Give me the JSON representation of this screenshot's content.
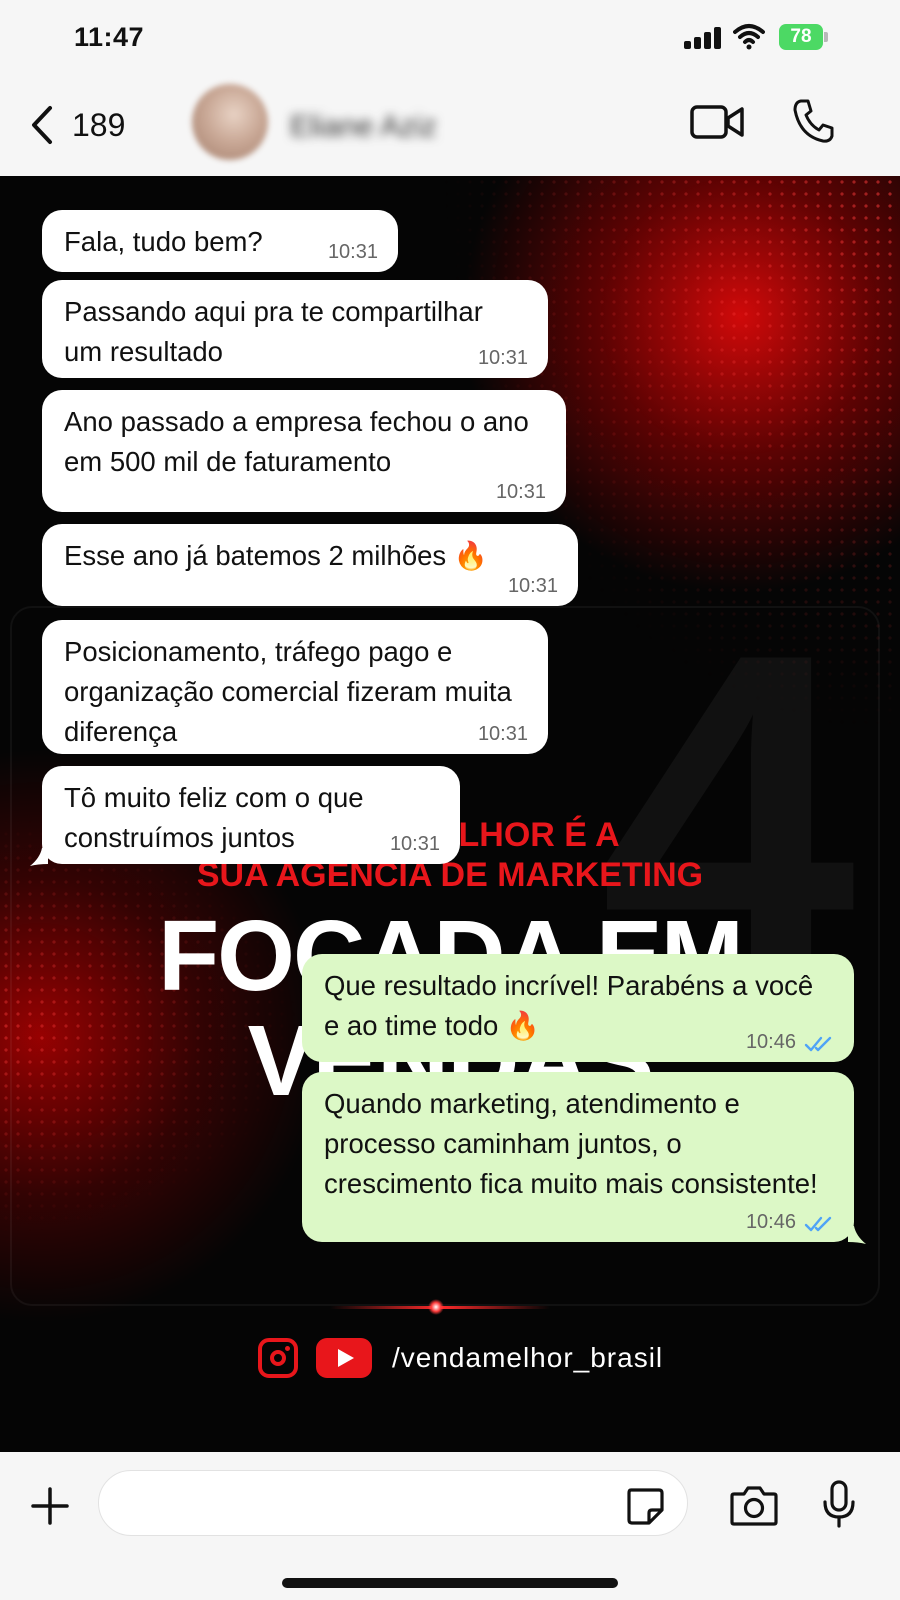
{
  "status_bar": {
    "time": "11:47",
    "battery": "78"
  },
  "header": {
    "back_count": "189",
    "contact_name": "Eliane Aziz",
    "icons": {
      "back": "chevron-left-icon",
      "video": "video-camera-icon",
      "call": "phone-icon"
    }
  },
  "wallpaper": {
    "subtitle_line1": "VENDA MELHOR É A",
    "subtitle_line2": "SUA AGÊNCIA DE MARKETING",
    "headline_line1": "FOCADA EM",
    "headline_line2": "VENDAS",
    "social_handle": "/vendamelhor_brasil",
    "accent_color": "#e8161b"
  },
  "messages": [
    {
      "direction": "in",
      "text": "Fala, tudo bem?",
      "time": "10:31"
    },
    {
      "direction": "in",
      "text": "Passando aqui pra te compartilhar um resultado",
      "time": "10:31"
    },
    {
      "direction": "in",
      "text": "Ano passado a empresa fechou o ano em 500 mil de faturamento",
      "time": "10:31"
    },
    {
      "direction": "in",
      "text": "Esse ano já batemos 2 milhões 🔥",
      "time": "10:31"
    },
    {
      "direction": "in",
      "text": "Posicionamento, tráfego pago e organização comercial fizeram muita diferença",
      "time": "10:31"
    },
    {
      "direction": "in",
      "text": "Tô muito feliz com o que construímos juntos",
      "time": "10:31"
    },
    {
      "direction": "out",
      "text": "Que resultado incrível! Parabéns a você e ao time todo 🔥",
      "time": "10:46",
      "status": "read"
    },
    {
      "direction": "out",
      "text": "Quando marketing, atendimento e processo caminham juntos, o crescimento fica muito mais consistente!",
      "time": "10:46",
      "status": "read"
    }
  ],
  "composer": {
    "placeholder": "",
    "icons": {
      "add": "plus-icon",
      "sticker": "sticker-icon",
      "camera": "camera-icon",
      "mic": "microphone-icon"
    }
  },
  "colors": {
    "incoming_bubble": "#ffffff",
    "outgoing_bubble": "#dcf8c6",
    "read_ticks": "#4fa3f7"
  }
}
